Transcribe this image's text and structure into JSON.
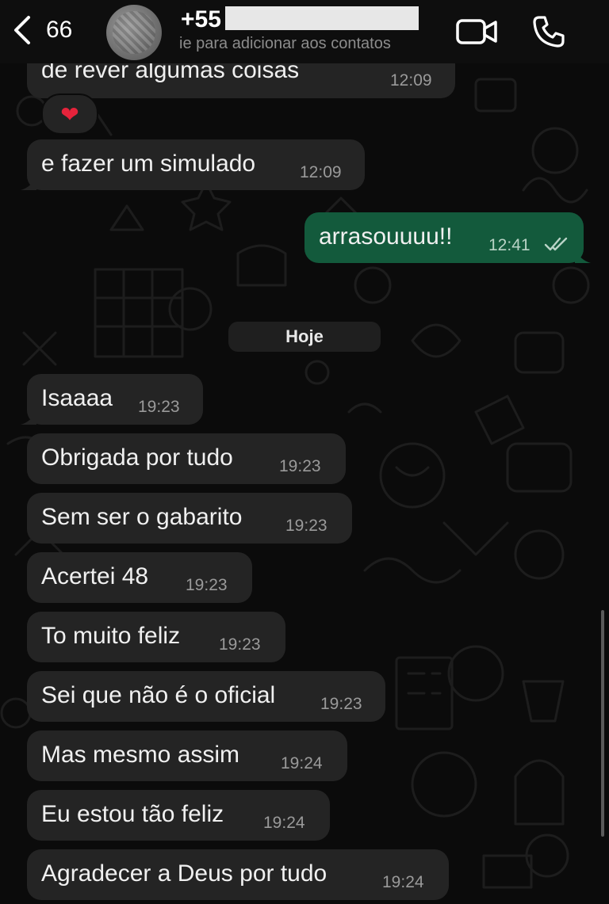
{
  "header": {
    "back_count": "66",
    "contact_name": "+55",
    "contact_subtitle": "ie para adicionar aos contatos",
    "icons": {
      "back": "chevron-left-icon",
      "video": "video-camera-icon",
      "call": "phone-icon"
    }
  },
  "messages_before": [
    {
      "text": "de rever algumas coisas",
      "time": "12:09",
      "direction": "in"
    },
    {
      "reaction": "❤",
      "reaction_color": "#e6233b"
    },
    {
      "text": "e fazer um simulado",
      "time": "12:09",
      "direction": "in"
    },
    {
      "text": "arrasouuuu!!",
      "time": "12:41",
      "direction": "out",
      "status": "read-double-check-icon"
    }
  ],
  "date_separator": "Hoje",
  "messages_today": [
    {
      "text": "Isaaaa",
      "time": "19:23"
    },
    {
      "text": "Obrigada por tudo",
      "time": "19:23"
    },
    {
      "text": "Sem ser o gabarito",
      "time": "19:23"
    },
    {
      "text": "Acertei 48",
      "time": "19:23"
    },
    {
      "text": "To muito feliz",
      "time": "19:23"
    },
    {
      "text": "Sei que não é o oficial",
      "time": "19:23"
    },
    {
      "text": "Mas mesmo assim",
      "time": "19:24"
    },
    {
      "text": "Eu estou tão feliz",
      "time": "19:24"
    },
    {
      "text": "Agradecer a Deus por tudo",
      "time": "19:24"
    }
  ],
  "colors": {
    "incoming_bubble": "#242424",
    "outgoing_bubble": "#135a3c",
    "background": "#0b0b0b"
  }
}
